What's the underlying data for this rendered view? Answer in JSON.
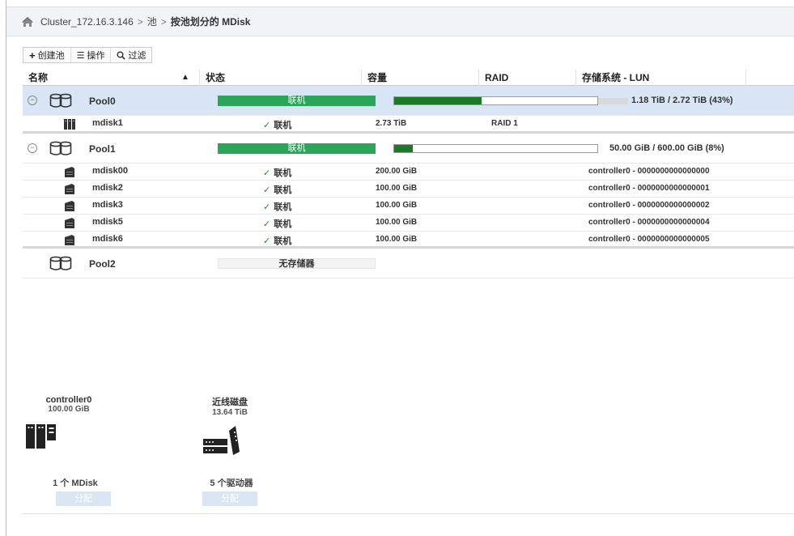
{
  "breadcrumb": {
    "cluster": "Cluster_172.16.3.146",
    "separator": ">",
    "pools": "池",
    "current": "按池划分的 MDisk"
  },
  "toolbar": {
    "create_pool": "创建池",
    "actions": "操作",
    "filter": "过滤"
  },
  "table": {
    "headers": {
      "name": "名称",
      "status": "状态",
      "capacity": "容量",
      "raid": "RAID",
      "storage_system": "存储系统 - LUN"
    },
    "pools": [
      {
        "name": "Pool0",
        "status": "联机",
        "capacity_used_fraction": 0.43,
        "capacity_text": "1.18 TiB / 2.72 TiB (43%)",
        "selected": true,
        "mdisks": [
          {
            "name": "mdisk1",
            "status": "联机",
            "capacity": "2.73 TiB",
            "raid": "RAID 1",
            "system": ""
          }
        ]
      },
      {
        "name": "Pool1",
        "status": "联机",
        "capacity_used_fraction": 0.08,
        "capacity_text": "50.00 GiB / 600.00 GiB (8%)",
        "selected": false,
        "mdisks": [
          {
            "name": "mdisk00",
            "status": "联机",
            "capacity": "200.00 GiB",
            "raid": "",
            "system": "controller0 - 0000000000000000"
          },
          {
            "name": "mdisk2",
            "status": "联机",
            "capacity": "100.00 GiB",
            "raid": "",
            "system": "controller0 - 0000000000000001"
          },
          {
            "name": "mdisk3",
            "status": "联机",
            "capacity": "100.00 GiB",
            "raid": "",
            "system": "controller0 - 0000000000000002"
          },
          {
            "name": "mdisk5",
            "status": "联机",
            "capacity": "100.00 GiB",
            "raid": "",
            "system": "controller0 - 0000000000000004"
          },
          {
            "name": "mdisk6",
            "status": "联机",
            "capacity": "100.00 GiB",
            "raid": "",
            "system": "controller0 - 0000000000000005"
          }
        ]
      },
      {
        "name": "Pool2",
        "status": "无存储器",
        "selected": false,
        "mdisks": []
      }
    ]
  },
  "details": {
    "controller": {
      "name": "controller0",
      "size": "100.00 GiB",
      "count": "1 个 MDisk",
      "assign": "分配"
    },
    "nearline": {
      "name": "近线磁盘",
      "size": "13.64 TiB",
      "count": "5 个驱动器",
      "assign": "分配"
    }
  },
  "colors": {
    "online_green": "#2aa55a",
    "capacity_fill": "#1a7a28",
    "selected_row": "#d7e5f4",
    "assign_button": "#d9e6f3"
  }
}
